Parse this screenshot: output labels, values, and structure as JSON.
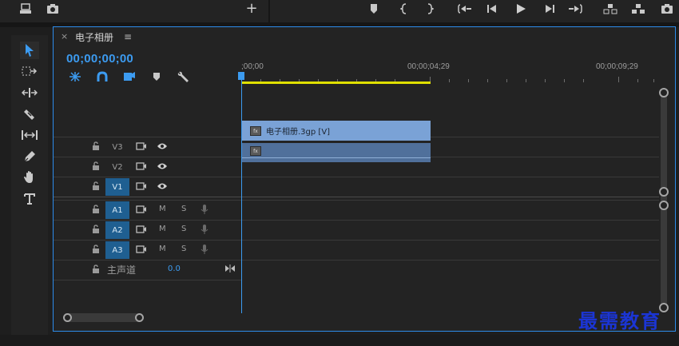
{
  "top_toolbar": {
    "left_icons": [
      "export-frame-icon",
      "camera-icon"
    ],
    "plus": "+",
    "right_icons": [
      "marker-icon",
      "mark-in-icon",
      "mark-out-icon",
      "go-to-in-icon",
      "step-back-icon",
      "play-icon",
      "step-forward-icon",
      "go-to-out-icon",
      "lift-icon",
      "extract-icon",
      "camera-icon"
    ]
  },
  "tools": [
    "selection-tool-icon",
    "track-select-tool-icon",
    "ripple-edit-tool-icon",
    "razor-tool-icon",
    "slip-tool-icon",
    "pen-tool-icon",
    "hand-tool-icon",
    "type-tool-icon"
  ],
  "sequence": {
    "title": "电子相册",
    "close": "×",
    "menu": "≡",
    "timecode": "00;00;00;00"
  },
  "header_icons": [
    "snap-icon",
    "linked-selection-icon",
    "add-marker-icon",
    "marker-icon",
    "wrench-icon"
  ],
  "ruler": {
    "labels": [
      ";00;00",
      "00;00;04;29",
      "00;00;09;29"
    ]
  },
  "tracks": {
    "video": [
      {
        "name": "V3",
        "active": false
      },
      {
        "name": "V2",
        "active": false
      },
      {
        "name": "V1",
        "active": true
      }
    ],
    "audio": [
      {
        "name": "A1",
        "active": true,
        "mute": "M",
        "solo": "S"
      },
      {
        "name": "A2",
        "active": true,
        "mute": "M",
        "solo": "S"
      },
      {
        "name": "A3",
        "active": true,
        "mute": "M",
        "solo": "S"
      }
    ],
    "master": {
      "label": "主声道",
      "value": "0.0"
    }
  },
  "clips": {
    "video_clip_name": "电子相册.3gp [V]",
    "fx_badge": "fx"
  },
  "watermark": "最需教育",
  "colors": {
    "accent": "#3c9bf0",
    "track_active": "#1f5f91",
    "video_clip": "#7aa2d6",
    "audio_clip": "#50709b",
    "work_area": "#e0e000",
    "watermark": "#1b35d4"
  }
}
